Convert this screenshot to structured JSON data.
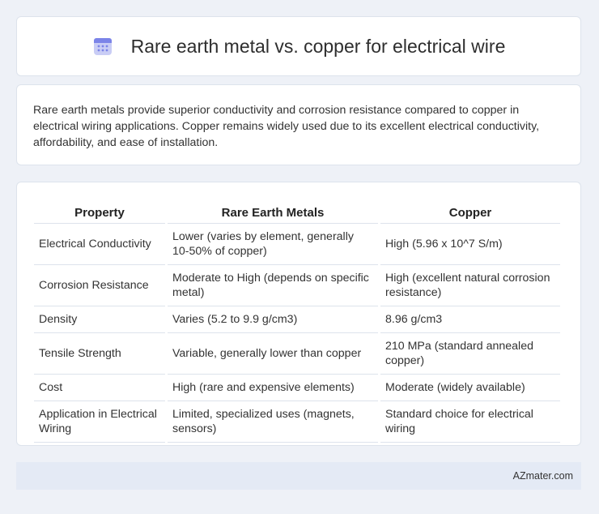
{
  "header": {
    "icon": "calendar-icon",
    "title": "Rare earth metal vs. copper for electrical wire"
  },
  "description": "Rare earth metals provide superior conductivity and corrosion resistance compared to copper in electrical wiring applications. Copper remains widely used due to its excellent electrical conductivity, affordability, and ease of installation.",
  "table": {
    "headers": [
      "Property",
      "Rare Earth Metals",
      "Copper"
    ],
    "rows": [
      [
        "Electrical Conductivity",
        "Lower (varies by element, generally 10-50% of copper)",
        "High (5.96 x 10^7 S/m)"
      ],
      [
        "Corrosion Resistance",
        "Moderate to High (depends on specific metal)",
        "High (excellent natural corrosion resistance)"
      ],
      [
        "Density",
        "Varies (5.2 to 9.9 g/cm3)",
        "8.96 g/cm3"
      ],
      [
        "Tensile Strength",
        "Variable, generally lower than copper",
        "210 MPa (standard annealed copper)"
      ],
      [
        "Cost",
        "High (rare and expensive elements)",
        "Moderate (widely available)"
      ],
      [
        "Application in Electrical Wiring",
        "Limited, specialized uses (magnets, sensors)",
        "Standard choice for electrical wiring"
      ]
    ]
  },
  "footer": {
    "brand": "AZmater.com"
  },
  "colors": {
    "background": "#eef1f7",
    "card": "#ffffff",
    "footer": "#e4eaf5",
    "icon_accent": "#7b84e8"
  }
}
